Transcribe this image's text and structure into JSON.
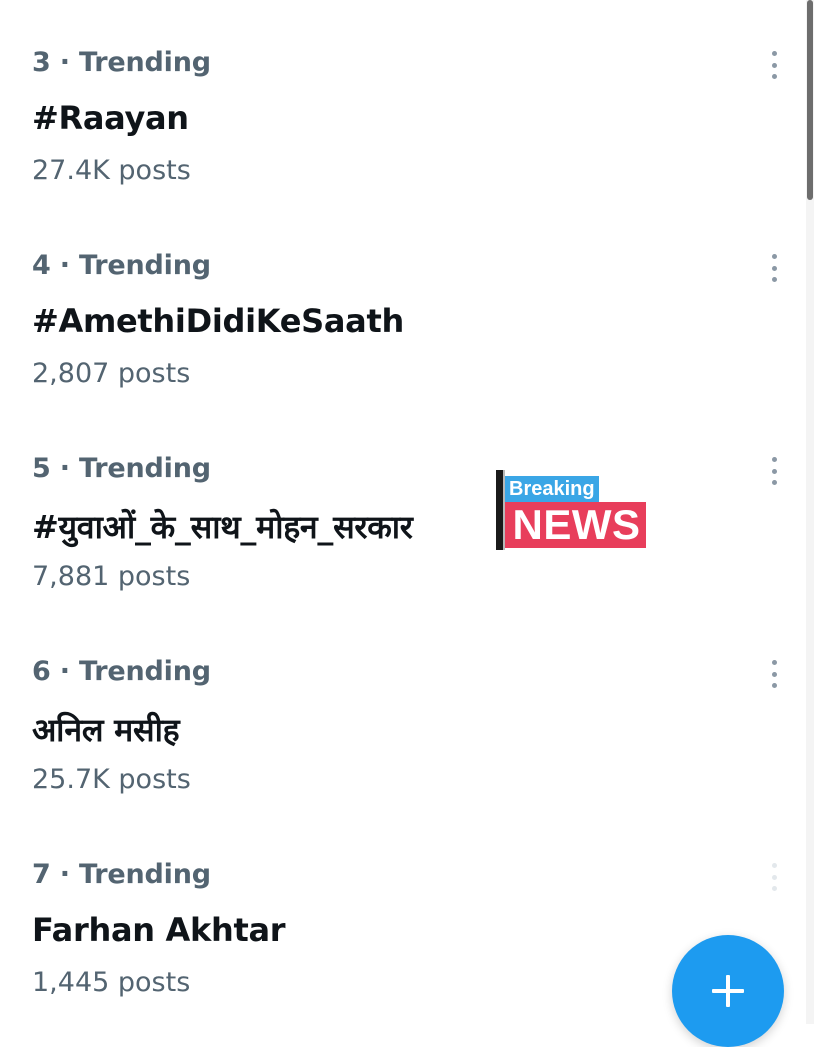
{
  "trends": [
    {
      "meta": "3 · Trending",
      "title": "#Raayan",
      "count": "27.4K posts"
    },
    {
      "meta": "4 · Trending",
      "title": "#AmethiDidiKeSaath",
      "count": "2,807 posts"
    },
    {
      "meta": "5 · Trending",
      "title": "#युवाओं_के_साथ_मोहन_सरकार",
      "count": "7,881 posts"
    },
    {
      "meta": "6 · Trending",
      "title": "अनिल मसीह",
      "count": "25.7K posts"
    },
    {
      "meta": "7 · Trending",
      "title": "Farhan Akhtar",
      "count": "1,445 posts"
    }
  ],
  "breaking_news_sticker": {
    "top_label": "Breaking",
    "bottom_label": "NEWS"
  },
  "icons": {
    "more": "more-vertical-icon",
    "compose": "plus-icon"
  },
  "colors": {
    "accent": "#1d9bf0",
    "secondary_text": "#536471",
    "primary_text": "#0f1419",
    "sticker_blue": "#3aa6e6",
    "sticker_red": "#e83e5b"
  }
}
